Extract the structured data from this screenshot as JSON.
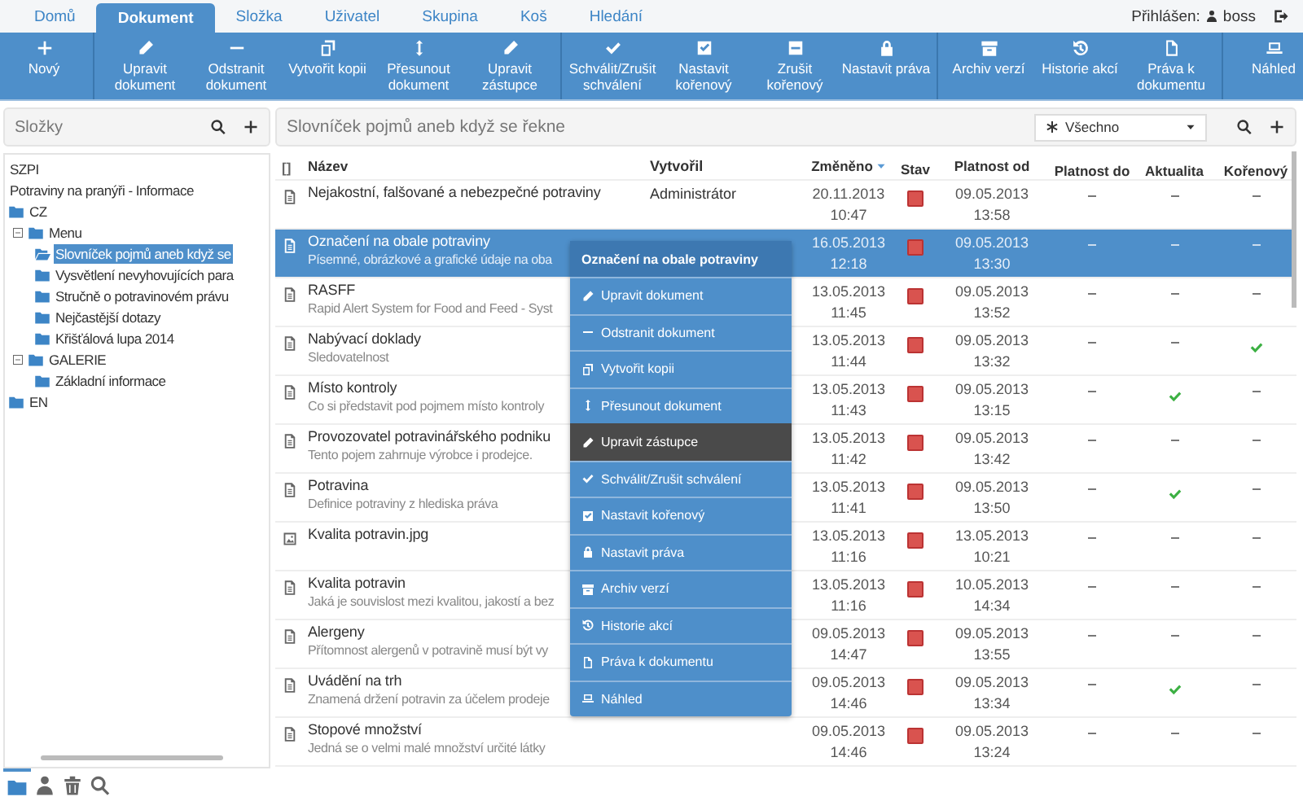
{
  "tabs": [
    {
      "label": "Domů",
      "selected": false
    },
    {
      "label": "Dokument",
      "selected": true
    },
    {
      "label": "Složka",
      "selected": false
    },
    {
      "label": "Uživatel",
      "selected": false
    },
    {
      "label": "Skupina",
      "selected": false
    },
    {
      "label": "Koš",
      "selected": false
    },
    {
      "label": "Hledání",
      "selected": false
    }
  ],
  "login": {
    "label": "Přihlášen:",
    "user": "boss"
  },
  "toolbar": {
    "groups": [
      [
        "Nový"
      ],
      [
        "Upravit dokument",
        "Odstranit dokument",
        "Vytvořit kopii",
        "Přesunout dokument",
        "Upravit zástupce"
      ],
      [
        "Schválit/Zrušit schválení",
        "Nastavit kořenový",
        "Zrušit kořenový",
        "Nastavit práva"
      ],
      [
        "Archiv verzí",
        "Historie akcí",
        "Práva k dokumentu"
      ],
      [
        "Náhled"
      ]
    ]
  },
  "sidebar": {
    "title": "Složky",
    "tree": [
      {
        "label": "SZPI",
        "kind": "plain"
      },
      {
        "label": "Potraviny na pranýři - Informace",
        "kind": "plain"
      },
      {
        "label": "CZ",
        "kind": "folder",
        "children": [
          {
            "label": "Menu",
            "kind": "folder",
            "expanded": true,
            "children": [
              {
                "label": "Slovníček pojmů aneb když se",
                "kind": "folder",
                "selected": true
              },
              {
                "label": "Vysvětlení nevyhovujících para",
                "kind": "folder",
                "selected": false
              },
              {
                "label": "Stručně o potravinovém právu",
                "kind": "folder",
                "selected": false
              },
              {
                "label": "Nejčastější dotazy",
                "kind": "folder",
                "selected": false
              },
              {
                "label": "Křišťálová lupa 2014",
                "kind": "folder",
                "selected": false
              }
            ]
          },
          {
            "label": "GALERIE",
            "kind": "folder",
            "expanded": true,
            "children": [
              {
                "label": "Základní informace",
                "kind": "folder",
                "selected": false
              }
            ]
          }
        ]
      },
      {
        "label": "EN",
        "kind": "folder"
      }
    ],
    "bottom_tabs": [
      {
        "selected": true
      },
      {
        "selected": false
      },
      {
        "selected": false
      },
      {
        "selected": false
      }
    ]
  },
  "content": {
    "title": "Slovníček pojmů aneb když se řekne",
    "filter": "Všechno"
  },
  "table": {
    "columns": [
      "[]",
      "Název",
      "Vytvořil",
      "Změněno",
      "Stav",
      "Platnost od",
      "Platnost do",
      "Aktualita",
      "Kořenový"
    ],
    "rows": [
      {
        "kind": "document",
        "name": "Nejakostní, falšované a nebezpečné potraviny",
        "author": "Administrátor",
        "changed": [
          "20.11.2013",
          "10:47"
        ],
        "approved": false,
        "valid_from": [
          "09.05.2013",
          "13:58"
        ],
        "aktualita": false,
        "root": false,
        "selected": false
      },
      {
        "kind": "document",
        "name": "Označení na obale potraviny",
        "description": "Písemné, obrázkové a grafické údaje na oba",
        "changed": [
          "16.05.2013",
          "12:18"
        ],
        "approved": false,
        "valid_from": [
          "09.05.2013",
          "13:30"
        ],
        "aktualita": false,
        "root": false,
        "selected": true
      },
      {
        "kind": "document",
        "name": "RASFF",
        "description": "Rapid Alert System for Food and Feed - Syst",
        "changed": [
          "13.05.2013",
          "11:45"
        ],
        "approved": false,
        "valid_from": [
          "09.05.2013",
          "13:52"
        ],
        "aktualita": false,
        "root": false,
        "selected": false
      },
      {
        "kind": "document",
        "name": "Nabývací doklady",
        "description": "Sledovatelnost",
        "changed": [
          "13.05.2013",
          "11:44"
        ],
        "approved": false,
        "valid_from": [
          "09.05.2013",
          "13:32"
        ],
        "aktualita": false,
        "root": true,
        "selected": false
      },
      {
        "kind": "document",
        "name": "Místo kontroly",
        "description": "Co si představit pod pojmem místo kontroly",
        "changed": [
          "13.05.2013",
          "11:43"
        ],
        "approved": false,
        "valid_from": [
          "09.05.2013",
          "13:15"
        ],
        "aktualita": true,
        "root": false,
        "selected": false
      },
      {
        "kind": "document",
        "name": "Provozovatel potravinářského podniku",
        "description": "Tento pojem zahrnuje výrobce i prodejce.",
        "changed": [
          "13.05.2013",
          "11:42"
        ],
        "approved": false,
        "valid_from": [
          "09.05.2013",
          "13:42"
        ],
        "aktualita": false,
        "root": false,
        "selected": false
      },
      {
        "kind": "document",
        "name": "Potravina",
        "description": "Definice potraviny z hlediska práva",
        "changed": [
          "13.05.2013",
          "11:41"
        ],
        "approved": false,
        "valid_from": [
          "09.05.2013",
          "13:50"
        ],
        "aktualita": true,
        "root": false,
        "selected": false
      },
      {
        "kind": "image",
        "name": "Kvalita potravin.jpg",
        "changed": [
          "13.05.2013",
          "11:16"
        ],
        "approved": false,
        "valid_from": [
          "13.05.2013",
          "10:21"
        ],
        "aktualita": false,
        "root": false,
        "selected": false
      },
      {
        "kind": "document",
        "name": "Kvalita potravin",
        "description": "Jaká je souvislost mezi kvalitou, jakostí a bez",
        "changed": [
          "13.05.2013",
          "11:16"
        ],
        "approved": false,
        "valid_from": [
          "10.05.2013",
          "14:34"
        ],
        "aktualita": false,
        "root": false,
        "selected": false
      },
      {
        "kind": "document",
        "name": "Alergeny",
        "description": "Přítomnost alergenů v potravině musí být vy",
        "changed": [
          "09.05.2013",
          "14:47"
        ],
        "approved": false,
        "valid_from": [
          "09.05.2013",
          "13:55"
        ],
        "aktualita": false,
        "root": false,
        "selected": false
      },
      {
        "kind": "document",
        "name": "Uvádění na trh",
        "description": "Znamená držení potravin za účelem prodeje",
        "changed": [
          "09.05.2013",
          "14:46"
        ],
        "approved": false,
        "valid_from": [
          "09.05.2013",
          "13:34"
        ],
        "aktualita": true,
        "root": false,
        "selected": false
      },
      {
        "kind": "document",
        "name": "Stopové množství",
        "description": "Jedná se o velmi malé množství určité látky",
        "changed": [
          "09.05.2013",
          "14:46"
        ],
        "approved": false,
        "valid_from": [
          "09.05.2013",
          "13:24"
        ],
        "aktualita": false,
        "root": false,
        "selected": false
      }
    ]
  },
  "context_menu": {
    "title": "Označení na obale potraviny",
    "items": [
      {
        "label": "Upravit dokument",
        "selected": false
      },
      {
        "label": "Odstranit dokument",
        "selected": false
      },
      {
        "label": "Vytvořit kopii",
        "selected": false
      },
      {
        "label": "Přesunout dokument",
        "selected": false
      },
      {
        "label": "Upravit zástupce",
        "selected": true
      },
      {
        "label": "Schválit/Zrušit schválení",
        "selected": false
      },
      {
        "label": "Nastavit kořenový",
        "selected": false
      },
      {
        "label": "Nastavit práva",
        "selected": false
      },
      {
        "label": "Archiv verzí",
        "selected": false
      },
      {
        "label": "Historie akcí",
        "selected": false
      },
      {
        "label": "Práva k dokumentu",
        "selected": false
      },
      {
        "label": "Náhled",
        "selected": false
      }
    ]
  }
}
